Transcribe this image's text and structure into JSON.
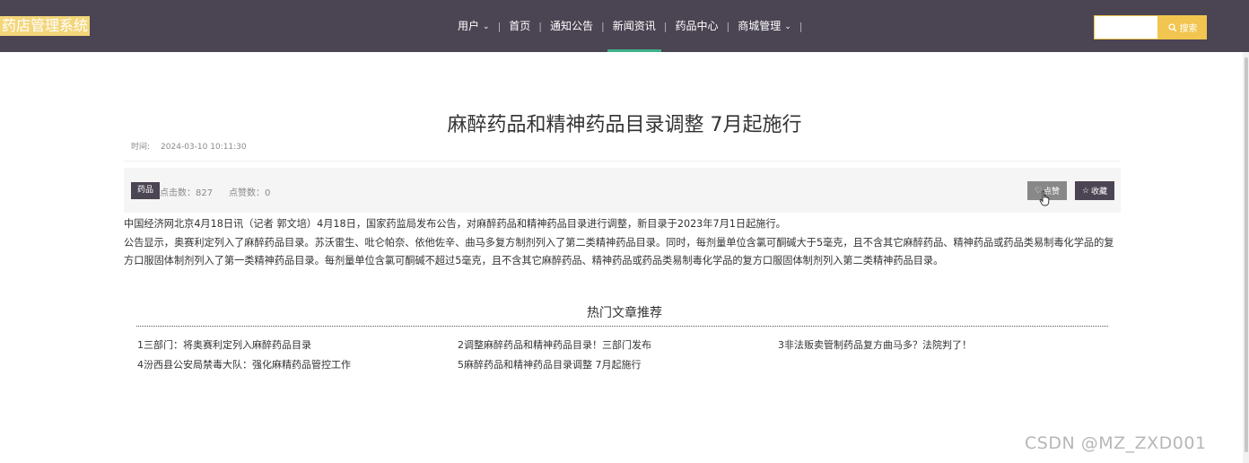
{
  "header": {
    "logo": "药店管理系统",
    "nav": [
      {
        "label": "用户",
        "has_dropdown": true
      },
      {
        "label": "首页"
      },
      {
        "label": "通知公告"
      },
      {
        "label": "新闻资讯",
        "active": true
      },
      {
        "label": "药品中心"
      },
      {
        "label": "商城管理",
        "has_dropdown": true
      }
    ],
    "search": {
      "placeholder": "",
      "button_label": "搜索",
      "button_icon": "search-icon"
    }
  },
  "article": {
    "title": "麻醉药品和精神药品目录调整 7月起施行",
    "time_label": "时间:",
    "time_value": "2024-03-10 10:11:30",
    "tag": "药品",
    "clicks_text": "点击数：827",
    "likes_text": "点赞数：0",
    "like_button": "点赞",
    "favorite_button": "收藏",
    "content_line1": "中国经济网北京4月18日讯（记者 郭文培）4月18日，国家药监局发布公告，对麻醉药品和精神药品目录进行调整，新目录于2023年7月1日起施行。",
    "content_line2": "公告显示，奥赛利定列入了麻醉药品目录。苏沃雷生、吡仑帕奈、依他佐辛、曲马多复方制剂列入了第二类精神药品目录。同时，每剂量单位含氯可酮碱大于5毫克，且不含其它麻醉药品、精神药品或药品类易制毒化学品的复方口服固体制剂列入了第一类精神药品目录。每剂量单位含氯可酮碱不超过5毫克，且不含其它麻醉药品、精神药品或药品类易制毒化学品的复方口服固体制剂列入第二类精神药品目录。"
  },
  "hot": {
    "title": "热门文章推荐",
    "items": [
      "1三部门：将奥赛利定列入麻醉药品目录",
      "2调整麻醉药品和精神药品目录！三部门发布",
      "3非法贩卖管制药品复方曲马多？法院判了！",
      "4汾西县公安局禁毒大队：强化麻精药品管控工作",
      "5麻醉药品和精神药品目录调整 7月起施行"
    ]
  },
  "watermark": "CSDN @MZ_ZXD001",
  "colors": {
    "header_bg": "#4b4453",
    "accent_yellow": "#f1c54f",
    "active_underline": "#3fb28a",
    "logo_bg": "#f3d67a"
  }
}
